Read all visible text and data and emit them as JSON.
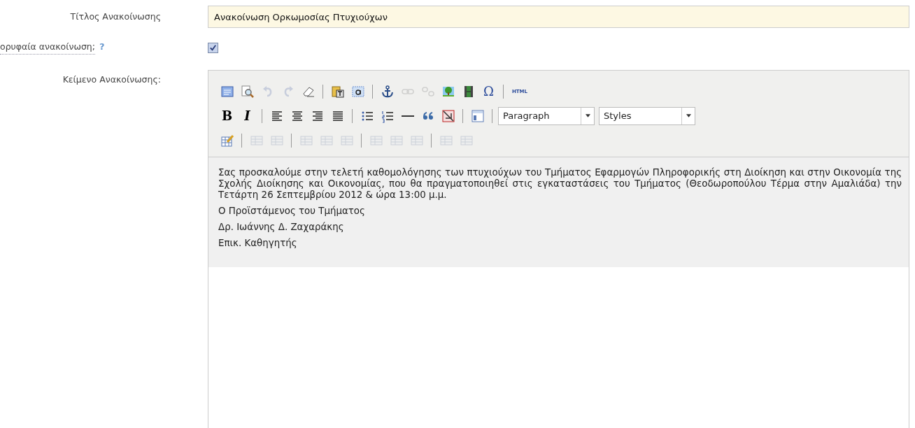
{
  "fields": [
    {
      "kind": "text",
      "label": "Τίτλος Ανακοίνωσης",
      "value": "Ανακοίνωση Ορκωμοσίας Πτυχιούχων"
    },
    {
      "kind": "checkbox",
      "label": "ορυφαία ανακοίνωση;",
      "help": "?",
      "checked": true
    },
    {
      "kind": "editor",
      "label": "Κείμενο Ανακοίνωσης:"
    }
  ],
  "toolbar": [
    [
      {
        "kind": "icon",
        "disabled": false
      },
      {
        "kind": "icon",
        "disabled": false
      },
      {
        "kind": "icon",
        "disabled": true
      },
      {
        "kind": "icon",
        "disabled": true
      },
      {
        "kind": "icon",
        "disabled": false
      },
      {
        "kind": "separator"
      },
      {
        "kind": "icon",
        "disabled": false
      },
      {
        "kind": "icon",
        "disabled": false
      },
      {
        "kind": "separator"
      },
      {
        "kind": "icon",
        "disabled": false
      },
      {
        "kind": "icon",
        "disabled": true
      },
      {
        "kind": "icon",
        "disabled": true
      },
      {
        "kind": "icon",
        "disabled": false
      },
      {
        "kind": "icon",
        "disabled": false
      },
      {
        "kind": "text",
        "label": "Ω",
        "disabled": false
      },
      {
        "kind": "separator"
      },
      {
        "kind": "text",
        "label": "HTML",
        "disabled": false
      }
    ],
    [
      {
        "kind": "text",
        "label": "B",
        "disabled": false
      },
      {
        "kind": "text",
        "label": "I",
        "disabled": false
      },
      {
        "kind": "separator"
      },
      {
        "kind": "icon",
        "disabled": false
      },
      {
        "kind": "icon",
        "disabled": false
      },
      {
        "kind": "icon",
        "disabled": false
      },
      {
        "kind": "icon",
        "disabled": false
      },
      {
        "kind": "separator"
      },
      {
        "kind": "icon",
        "disabled": false
      },
      {
        "kind": "icon",
        "disabled": false
      },
      {
        "kind": "icon",
        "disabled": false
      },
      {
        "kind": "icon",
        "disabled": false
      },
      {
        "kind": "icon",
        "disabled": false
      },
      {
        "kind": "separator"
      },
      {
        "kind": "icon",
        "disabled": false
      },
      {
        "kind": "separator"
      },
      {
        "kind": "select",
        "value": "Paragraph"
      },
      {
        "kind": "select",
        "value": "Styles"
      }
    ],
    [
      {
        "kind": "icon",
        "disabled": false
      },
      {
        "kind": "separator"
      },
      {
        "kind": "icon",
        "disabled": true
      },
      {
        "kind": "icon",
        "disabled": true
      },
      {
        "kind": "separator"
      },
      {
        "kind": "icon",
        "disabled": true
      },
      {
        "kind": "icon",
        "disabled": true
      },
      {
        "kind": "icon",
        "disabled": true
      },
      {
        "kind": "separator"
      },
      {
        "kind": "icon",
        "disabled": true
      },
      {
        "kind": "icon",
        "disabled": true
      },
      {
        "kind": "icon",
        "disabled": true
      },
      {
        "kind": "separator"
      },
      {
        "kind": "icon",
        "disabled": true
      },
      {
        "kind": "icon",
        "disabled": true
      }
    ]
  ],
  "content": [
    "Σας προσκαλούμε στην τελετή καθομολόγησης των πτυχιούχων του Τμήματος Εφαρμογών Πληροφορικής στη Διοίκηση και στην Οικονομία της Σχολής Διοίκησης και Οικονομίας, που θα πραγματοποιηθεί στις εγκαταστάσεις του Τμήματος (Θεοδωροπούλου Τέρμα στην Αμαλιάδα) την Τετάρτη 26 Σεπτεμβρίου 2012 & ώρα 13:00 μ.μ.",
    "Ο Προϊστάμενος του Τμήματος",
    "Δρ. Ιωάννης Δ. Ζαχαράκης",
    "Επικ. Καθηγητής"
  ]
}
